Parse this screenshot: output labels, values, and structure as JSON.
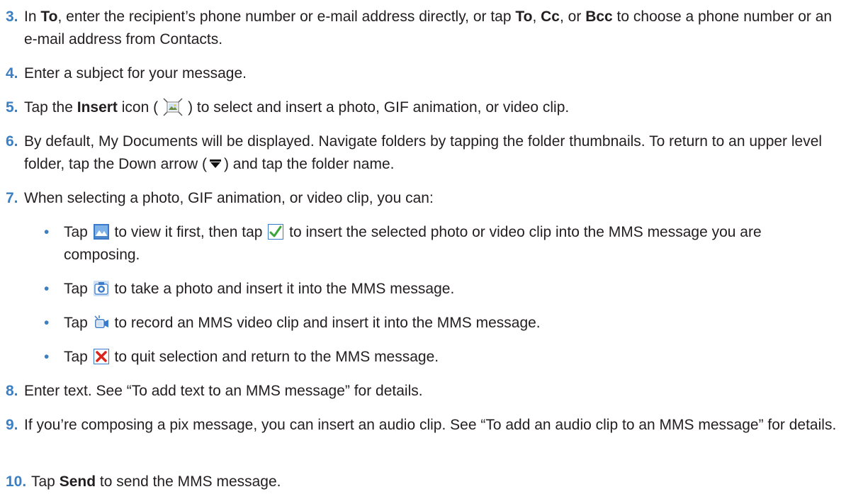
{
  "steps": [
    {
      "num": "3.",
      "parts": [
        "In ",
        "To",
        ", enter the recipient’s phone number or e-mail address directly, or tap ",
        "To",
        ", ",
        "Cc",
        ", or ",
        "Bcc",
        " to choose a phone number or an e-mail address from Contacts."
      ]
    },
    {
      "num": "4.",
      "text": "Enter a subject for your message."
    },
    {
      "num": "5.",
      "parts": [
        "Tap the ",
        "Insert",
        " icon (",
        ") to select and insert a photo, GIF animation, or video clip."
      ]
    },
    {
      "num": "6.",
      "parts": [
        "By default, My Documents will be displayed. Navigate folders by tapping the folder thumbnails. To return to an upper level folder, tap the Down arrow (",
        ") and tap the folder name."
      ]
    },
    {
      "num": "7.",
      "text": "When selecting a photo, GIF animation, or video clip, you can:"
    },
    {
      "num": "8.",
      "text": "Enter text. See “To add text to an MMS message” for details."
    },
    {
      "num": "9.",
      "text": "If you’re composing a pix message, you can insert an audio clip. See “To add an audio clip to an MMS message” for details."
    },
    {
      "num": "10.",
      "parts": [
        "Tap ",
        "Send",
        " to send the MMS message."
      ]
    }
  ],
  "bullets": [
    {
      "parts": [
        "Tap ",
        " to view it first, then tap ",
        " to insert the selected photo or video clip into the MMS message you are composing."
      ]
    },
    {
      "parts": [
        "Tap ",
        " to take a photo and insert it into the MMS message."
      ]
    },
    {
      "parts": [
        "Tap ",
        " to record an MMS video clip and insert it into the MMS message."
      ]
    },
    {
      "parts": [
        "Tap ",
        " to quit selection and return to the MMS message."
      ]
    }
  ],
  "bullet_glyph": "•",
  "icons": {
    "insert": "insert-media-icon",
    "down": "down-arrow-icon",
    "view": "view-photo-icon",
    "check": "checkmark-icon",
    "camera": "camera-icon",
    "video": "video-camera-icon",
    "close": "close-x-icon"
  },
  "colors": {
    "step_number": "#3b7fc4",
    "text": "#231f20",
    "check_green": "#3aa53a",
    "close_red": "#d9251c",
    "icon_blue": "#3a7ac8"
  }
}
